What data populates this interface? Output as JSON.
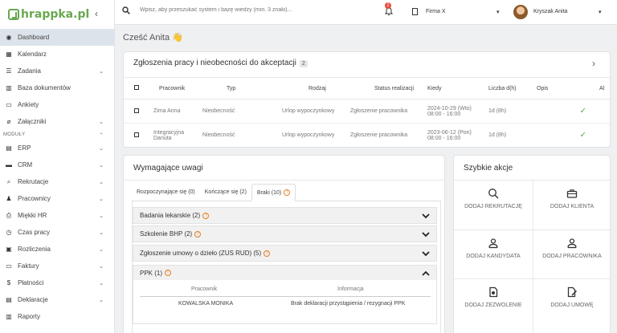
{
  "brand": {
    "logo_text": "hrappka.pl",
    "collapse": "‹"
  },
  "sidebar": {
    "items": [
      {
        "label": "Dashboard",
        "icon": "dashboard-icon",
        "glyph": "◉",
        "chev": ""
      },
      {
        "label": "Kalendarz",
        "icon": "calendar-icon",
        "glyph": "▦",
        "chev": ""
      },
      {
        "label": "Zadania",
        "icon": "tasks-icon",
        "glyph": "☰",
        "chev": "⌄"
      },
      {
        "label": "Baza dokumentów",
        "icon": "documents-icon",
        "glyph": "▥",
        "chev": ""
      },
      {
        "label": "Ankiety",
        "icon": "survey-icon",
        "glyph": "▭",
        "chev": ""
      },
      {
        "label": "Załączniki",
        "icon": "paperclip-icon",
        "glyph": "⌀",
        "chev": "⌄"
      }
    ],
    "section_label": "MODUŁY",
    "section_chev": "⌃",
    "modules": [
      {
        "label": "ERP",
        "icon": "erp-icon",
        "glyph": "▤",
        "chev": "⌄"
      },
      {
        "label": "CRM",
        "icon": "briefcase-icon",
        "glyph": "▬",
        "chev": "⌄"
      },
      {
        "label": "Rekrutacje",
        "icon": "search-icon",
        "glyph": "⌕",
        "chev": "⌄"
      },
      {
        "label": "Pracownicy",
        "icon": "people-icon",
        "glyph": "♟",
        "chev": "⌄"
      },
      {
        "label": "Miękki HR",
        "icon": "soft-hr-icon",
        "glyph": "⎙",
        "chev": "⌄"
      },
      {
        "label": "Czas pracy",
        "icon": "worktime-icon",
        "glyph": "◷",
        "chev": "⌄"
      },
      {
        "label": "Rozliczenia",
        "icon": "settlements-icon",
        "glyph": "▣",
        "chev": "⌄"
      },
      {
        "label": "Faktury",
        "icon": "invoice-icon",
        "glyph": "▭",
        "chev": "⌄"
      },
      {
        "label": "Płatności",
        "icon": "dollar-icon",
        "glyph": "$",
        "chev": "⌄"
      },
      {
        "label": "Deklaracje",
        "icon": "declarations-icon",
        "glyph": "▤",
        "chev": "⌄"
      },
      {
        "label": "Raporty",
        "icon": "reports-icon",
        "glyph": "▥",
        "chev": ""
      }
    ]
  },
  "topbar": {
    "search_placeholder": "Wpisz, aby przeszukać system i bazę wiedzy (min. 3 znaki)...",
    "notification_count": "2",
    "company": "Firma X",
    "user_name": "Kryszak Anita",
    "dropdown_glyph": "▾"
  },
  "greeting": "Cześć Anita 👋",
  "requests": {
    "title": "Zgłoszenia pracy i nieobecności do akceptacji",
    "count": "2",
    "arrow": "›",
    "columns": [
      "Pracownik",
      "Typ",
      "Rodzaj",
      "Status realizacji",
      "Kiedy",
      "Liczba d(h)",
      "Opis",
      "Al"
    ],
    "rows": [
      {
        "employee": "Zima Anna",
        "type": "Nieobecność",
        "kind": "Urlop wypoczynkowy",
        "status": "Zgłoszenie pracownika",
        "when_date": "2024-10-29 (Wto)",
        "when_time": "08:00 - 16:00",
        "count": "1d (8h)",
        "check": "✓"
      },
      {
        "employee": "Integracyjna Danuta",
        "type": "Nieobecność",
        "kind": "Urlop wypoczynkowy",
        "status": "Zgłoszenie pracownika",
        "when_date": "2023-06-12 (Pon)",
        "when_time": "08:00 - 16:00",
        "count": "1d (8h)",
        "check": "✓"
      }
    ]
  },
  "attention": {
    "title": "Wymagające uwagi",
    "tabs": [
      "Rozpoczynające się (0)",
      "Kończące się (2)",
      "Braki (10)"
    ],
    "warn_glyph": "!",
    "accordions": [
      "Badania lekarskie (2)",
      "Szkolenie BHP (2)",
      "Zgłoszenie umowy o dzieło (ZUS RUD) (5)",
      "PPK (1)"
    ],
    "ppk_table": {
      "col_employee": "Pracownik",
      "col_info": "Informacja",
      "employee": "KOWALSKA MONIKA",
      "info": "Brak deklaracji przystąpienia / rezygnacji PPK"
    }
  },
  "quick_actions": {
    "title": "Szybkie akcje",
    "items": [
      {
        "label": "DODAJ REKRUTACJĘ",
        "icon": "search-icon"
      },
      {
        "label": "DODAJ KLIENTA",
        "icon": "briefcase-icon"
      },
      {
        "label": "DODAJ KANDYDATA",
        "icon": "user-icon"
      },
      {
        "label": "DODAJ PRACOWNIKA",
        "icon": "user-icon"
      },
      {
        "label": "DODAJ ZEZWOLENIE",
        "icon": "permit-icon"
      },
      {
        "label": "DODAJ UMOWĘ",
        "icon": "contract-icon"
      }
    ]
  },
  "colors": {
    "brand_green": "#6aa84f",
    "check_green": "#4caf50",
    "warning_orange": "#e67e22",
    "badge_red": "#e74c3c",
    "active_nav": "#dde3ea"
  }
}
